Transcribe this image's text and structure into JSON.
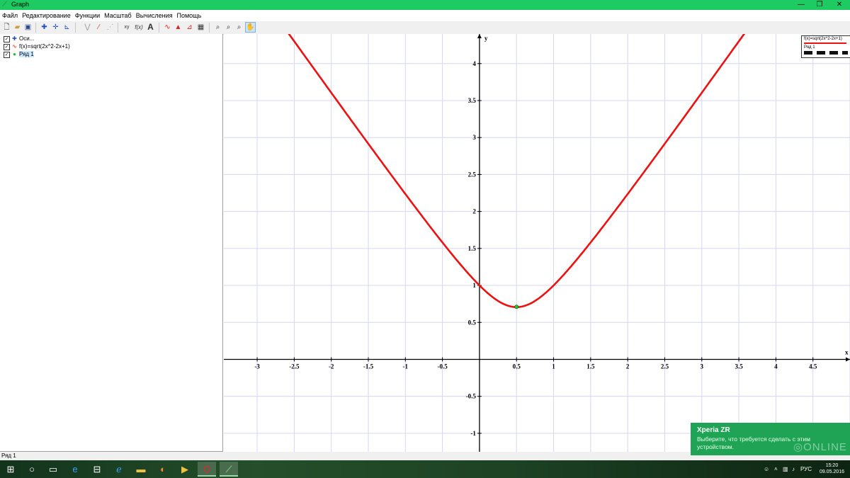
{
  "window": {
    "title": "Graph",
    "minimize_glyph": "—",
    "maximize_glyph": "❐",
    "close_glyph": "✕",
    "accent": "#1ecb62"
  },
  "menu": [
    "Файл",
    "Редактирование",
    "Функции",
    "Масштаб",
    "Вычисления",
    "Помощь"
  ],
  "toolbar": {
    "icons": [
      "new-icon",
      "open-icon",
      "save-icon",
      "insert-function-icon",
      "insert-tangent-icon",
      "insert-series-icon",
      "shade-icon",
      "relation-icon",
      "point-series-icon",
      "text-label-icon",
      "text-icon",
      "derivative-icon",
      "area-icon",
      "trendline-icon",
      "table-icon",
      "zoom-in-icon",
      "zoom-out-icon",
      "zoom-fit-icon",
      "pan-hand-icon"
    ],
    "glyphs": {
      "text_label": "xy",
      "func": "f(x)",
      "text": "A"
    }
  },
  "tree": [
    {
      "label": "Оси...",
      "checked": true,
      "icon": "axes-icon"
    },
    {
      "label": "f(x)=sqrt(2x^2-2x+1)",
      "checked": true,
      "icon": "function-icon"
    },
    {
      "label": "Ряд 1",
      "checked": true,
      "icon": "point-series-icon",
      "selected": true
    }
  ],
  "chart_data": {
    "type": "line",
    "x_axis_label": "x",
    "y_axis_label": "y",
    "xlim": [
      -3.45,
      5.0
    ],
    "ylim": [
      -1.25,
      4.4
    ],
    "x_ticks": [
      -3,
      -2.5,
      -2,
      -1.5,
      -1,
      -0.5,
      0.5,
      1,
      1.5,
      2,
      2.5,
      3,
      3.5,
      4,
      4.5
    ],
    "x_tick_labels": [
      "-3",
      "-2.5",
      "-2",
      "-1.5",
      "-1",
      "-0.5",
      "0.5",
      "1",
      "1.5",
      "2",
      "2.5",
      "3",
      "3.5",
      "4",
      "4.5"
    ],
    "y_ticks": [
      -1,
      -0.5,
      0.5,
      1,
      1.5,
      2,
      2.5,
      3,
      3.5,
      4
    ],
    "y_tick_labels": [
      "-1",
      "-0.5",
      "0.5",
      "1",
      "1.5",
      "2",
      "2.5",
      "3",
      "3.5",
      "4"
    ],
    "grid": true,
    "legend_position": "top-right",
    "series": [
      {
        "name": "f(x)=sqrt(2x^2-2x+1)",
        "kind": "function",
        "color": "#ee1111",
        "x_range": [
          -2.6,
          3.6
        ],
        "x": [
          -2.5,
          -2,
          -1.5,
          -1,
          -0.5,
          0,
          0.5,
          1,
          1.5,
          2,
          2.5,
          3,
          3.5
        ],
        "y": [
          4.18,
          3.61,
          2.92,
          2.24,
          1.58,
          1.0,
          0.71,
          1.0,
          1.58,
          2.24,
          2.92,
          3.61,
          4.3
        ]
      },
      {
        "name": "Ряд 1",
        "kind": "points",
        "color": "#22cc22",
        "x": [
          0.5
        ],
        "y": [
          0.71
        ]
      }
    ]
  },
  "status": {
    "text": "Ряд 1"
  },
  "notification": {
    "title": "Xperia ZR",
    "message": "Выберите, что требуется сделать с этим устройством.",
    "color": "#1fa354"
  },
  "taskbar": {
    "apps": [
      "start-icon",
      "search-icon",
      "task-view-icon",
      "edge-icon",
      "store-icon",
      "ie-icon",
      "explorer-icon",
      "app-icon",
      "media-icon",
      "opera-icon",
      "graph-app-icon"
    ],
    "language": "РУС",
    "time": "15:20",
    "date": "09.05.2016"
  },
  "watermark": "ONLINE"
}
